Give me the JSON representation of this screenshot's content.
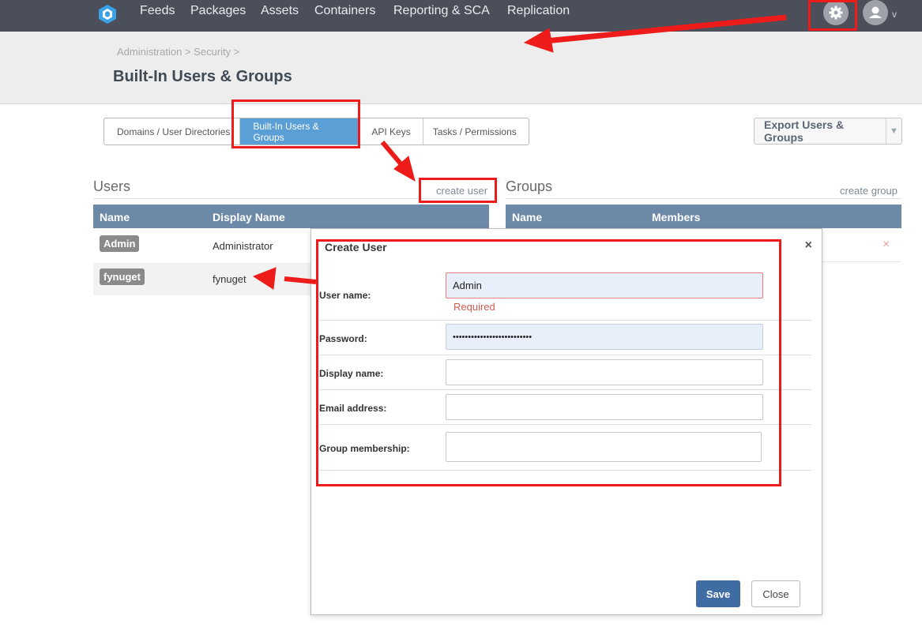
{
  "nav": {
    "items": [
      "Feeds",
      "Packages",
      "Assets",
      "Containers",
      "Reporting & SCA",
      "Replication"
    ],
    "user_caret": "v"
  },
  "breadcrumb": "Administration > Security >",
  "page_title": "Built-In Users & Groups",
  "tabs": [
    {
      "label": "Domains / User Directories",
      "active": false
    },
    {
      "label": "Built-In Users & Groups",
      "active": true
    },
    {
      "label": "API Keys",
      "active": false
    },
    {
      "label": "Tasks / Permissions",
      "active": false
    }
  ],
  "export_button": "Export Users & Groups",
  "users": {
    "title": "Users",
    "create_link": "create user",
    "columns": [
      "Name",
      "Display Name"
    ],
    "rows": [
      {
        "name": "Admin",
        "display": "Administrator"
      },
      {
        "name": "fynuget",
        "display": "fynuget"
      }
    ]
  },
  "groups": {
    "title": "Groups",
    "create_link": "create group",
    "columns": [
      "Name",
      "Members"
    ]
  },
  "modal": {
    "title": "Create User",
    "close": "×",
    "fields": {
      "username": {
        "label": "User name:",
        "value": "Admin",
        "error": "Required"
      },
      "password": {
        "label": "Password:",
        "value": "••••••••••••••••••••••••••"
      },
      "display_name": {
        "label": "Display name:",
        "value": ""
      },
      "email": {
        "label": "Email address:",
        "value": ""
      },
      "groups": {
        "label": "Group membership:",
        "value": ""
      }
    },
    "save": "Save",
    "close_button": "Close"
  },
  "delete_icon": "×",
  "colors": {
    "nav_bg": "#4a4f5a",
    "tab_active": "#5b9fd7",
    "table_header": "#6d89a8",
    "save_button": "#3f6ca3",
    "annotation": "#ee1b1b"
  }
}
